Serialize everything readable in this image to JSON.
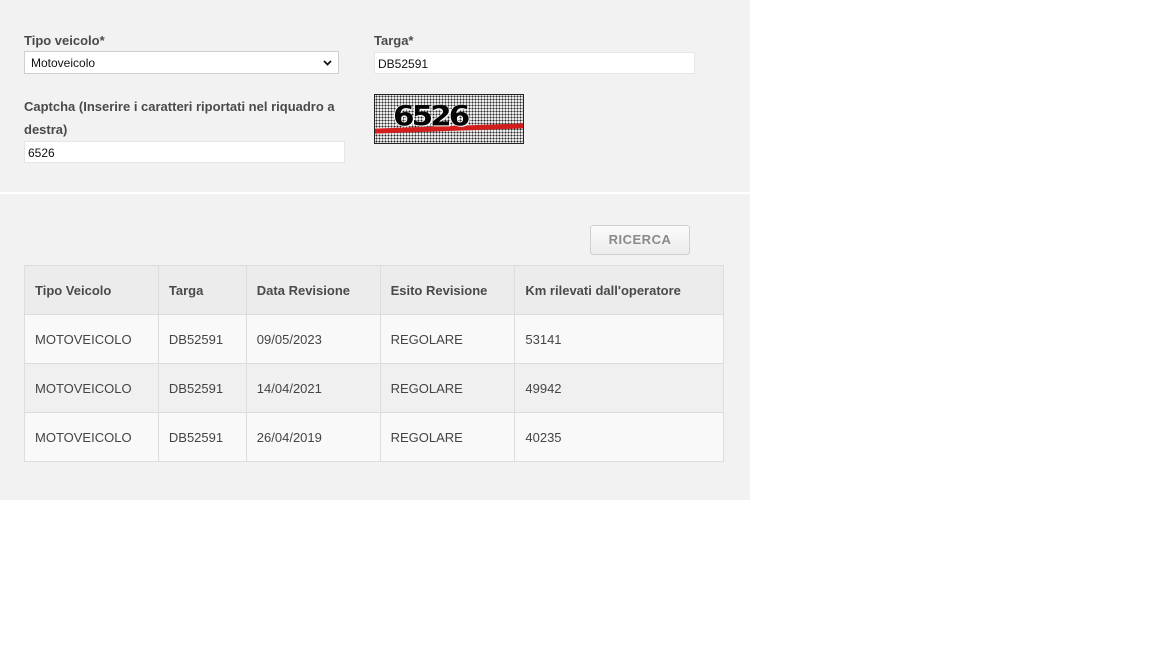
{
  "form": {
    "vehicle_type_label": "Tipo veicolo*",
    "vehicle_type_value": "Motoveicolo",
    "plate_label": "Targa*",
    "plate_value": "DB52591",
    "captcha_label_line1": "Captcha (Inserire i caratteri riportati nel riquadro a",
    "captcha_label_line2": "destra)",
    "captcha_value": "6526",
    "captcha_image_text": "6526",
    "search_button": "RICERCA"
  },
  "table": {
    "headers": [
      "Tipo Veicolo",
      "Targa",
      "Data Revisione",
      "Esito Revisione",
      "Km rilevati dall'operatore"
    ],
    "rows": [
      [
        "MOTOVEICOLO",
        "DB52591",
        "09/05/2023",
        "REGOLARE",
        "53141"
      ],
      [
        "MOTOVEICOLO",
        "DB52591",
        "14/04/2021",
        "REGOLARE",
        "49942"
      ],
      [
        "MOTOVEICOLO",
        "DB52591",
        "26/04/2019",
        "REGOLARE",
        "40235"
      ]
    ]
  },
  "colors": {
    "panel_background": "#f3f2f2",
    "header_row": "#ececec",
    "captcha_line": "#d21d1d"
  },
  "icons": {
    "select_chevron": "chevron-down-icon"
  }
}
